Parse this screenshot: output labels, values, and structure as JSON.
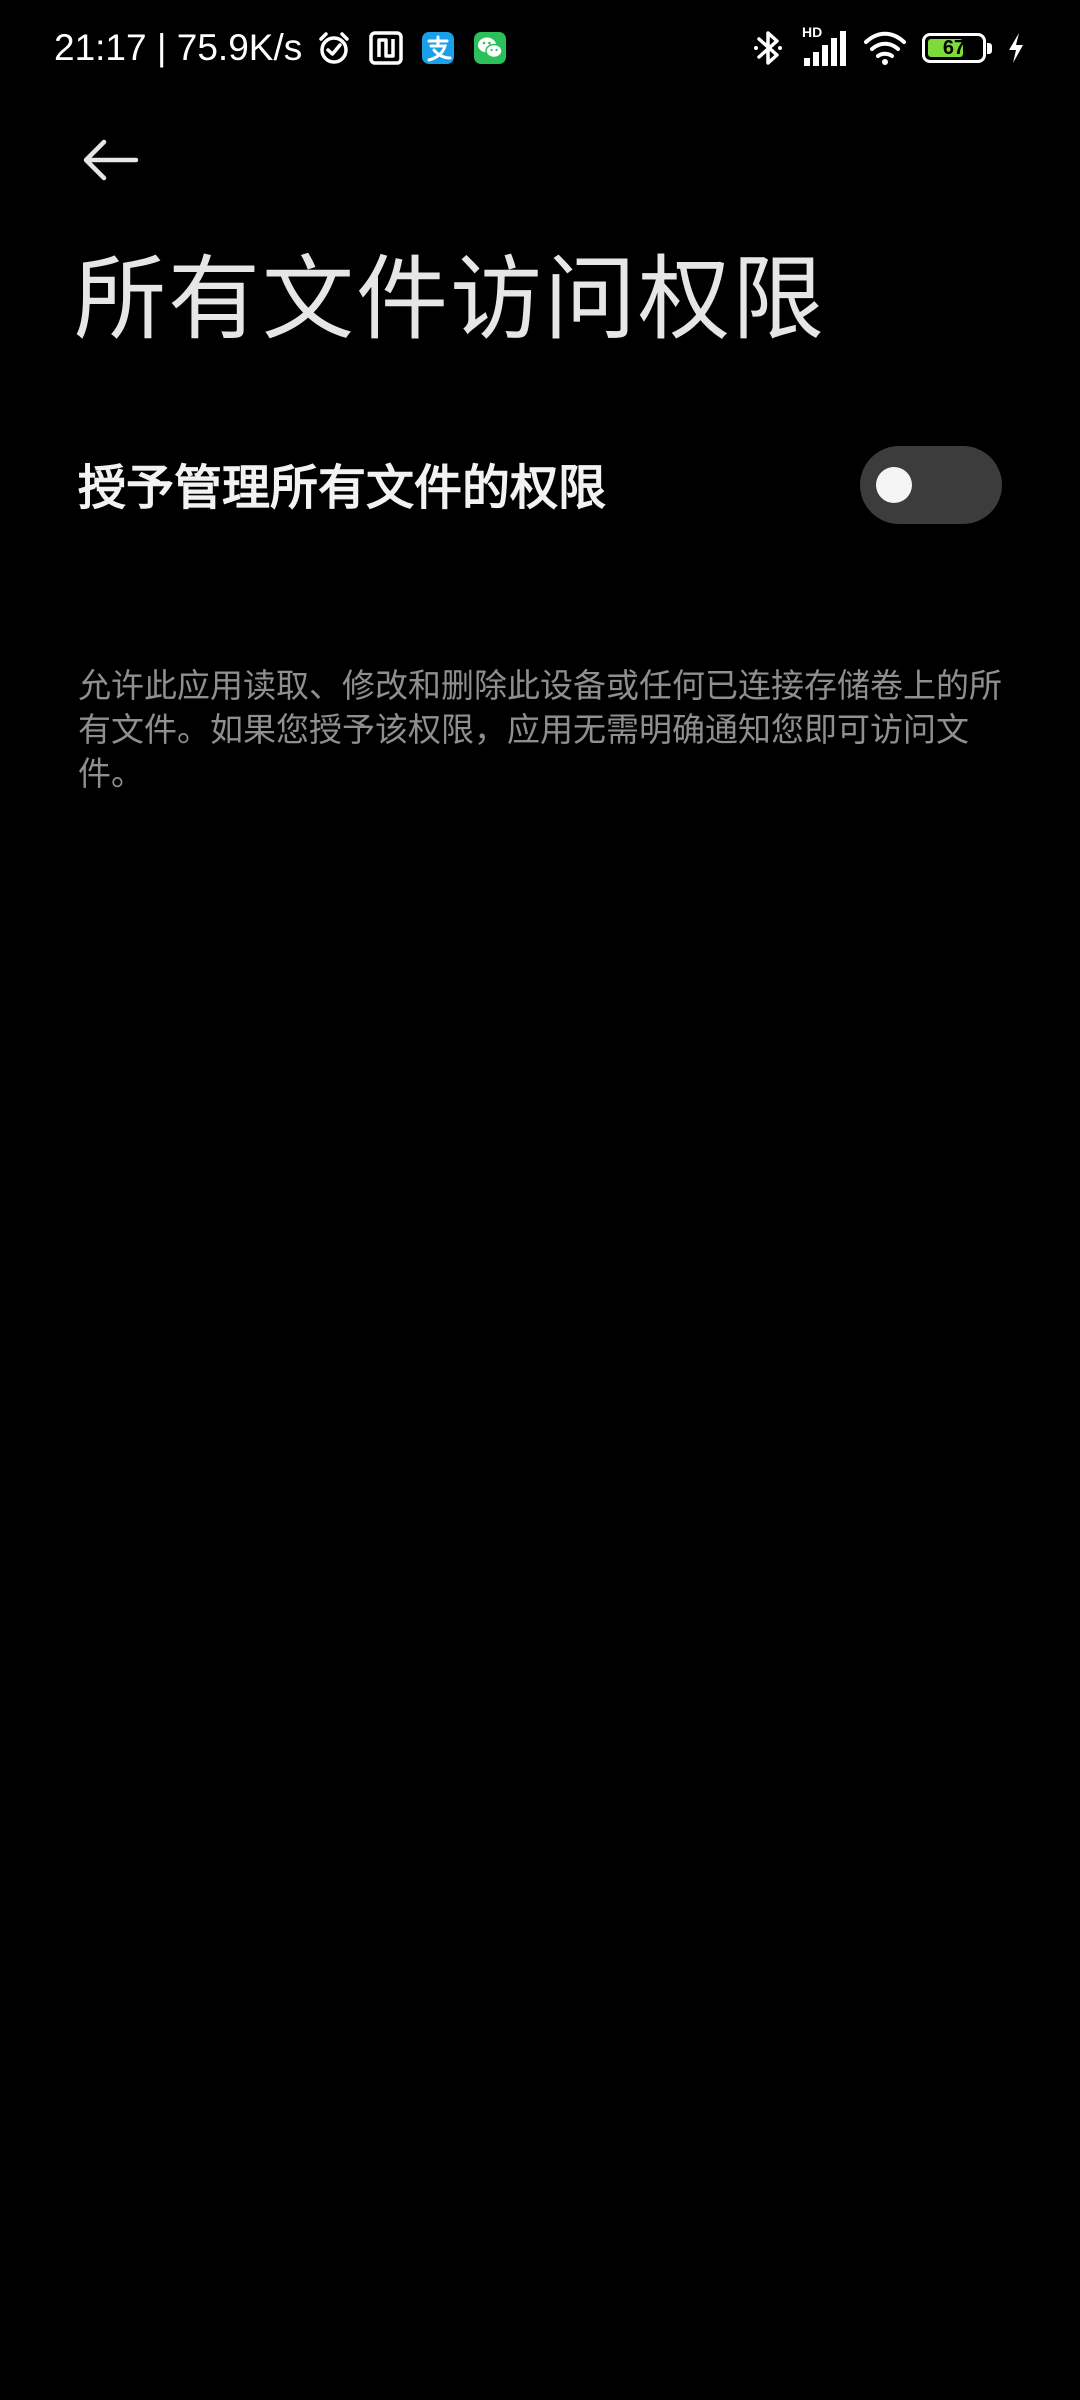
{
  "status_bar": {
    "time_speed": "21:17 | 75.9K/s",
    "network_badge": "HD",
    "battery_level": "67",
    "battery_fraction": 0.67
  },
  "icons": {
    "back": "arrow-left-icon",
    "alarm": "alarm-icon",
    "nfc": "nfc-icon",
    "alipay": "alipay-icon",
    "wechat": "wechat-icon",
    "bluetooth": "bluetooth-icon",
    "signal": "signal-icon",
    "wifi": "wifi-icon",
    "battery": "battery-icon",
    "charging": "charging-bolt-icon"
  },
  "colors": {
    "background": "#000000",
    "alipay": "#1aa0e8",
    "wechat": "#2bc05a",
    "battery_fill": "#7ddc3b",
    "toggle_off": "#3c3c3c"
  },
  "page": {
    "title": "所有文件访问权限",
    "setting_label": "授予管理所有文件的权限",
    "toggle_on": false,
    "description": "允许此应用读取、修改和删除此设备或任何已连接存储卷上的所有文件。如果您授予该权限，应用无需明确通知您即可访问文件。"
  }
}
